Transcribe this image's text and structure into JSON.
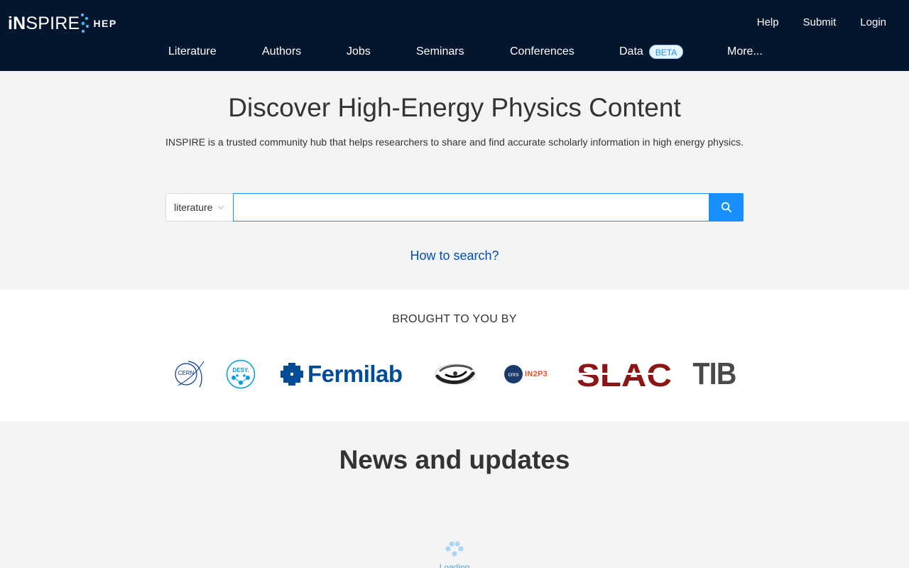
{
  "header": {
    "logo_text_bold": "iN",
    "logo_text_rest": "SPIRE",
    "logo_sub": "HEP",
    "top_links": [
      "Help",
      "Submit",
      "Login"
    ],
    "nav": [
      {
        "label": "Literature"
      },
      {
        "label": "Authors"
      },
      {
        "label": "Jobs"
      },
      {
        "label": "Seminars"
      },
      {
        "label": "Conferences"
      },
      {
        "label": "Data",
        "badge": "BETA"
      },
      {
        "label": "More..."
      }
    ]
  },
  "hero": {
    "title": "Discover High-Energy Physics Content",
    "subtitle": "INSPIRE is a trusted community hub that helps researchers to share and find accurate scholarly information in high energy physics.",
    "search": {
      "scope": "literature",
      "value": "",
      "placeholder": ""
    },
    "how_to_search": "How to search?"
  },
  "sponsors": {
    "title": "BROUGHT TO YOU BY",
    "cern": "CERN",
    "desy": "DESY.",
    "fermilab": "Fermilab",
    "cnrs": "cnrs",
    "in2p3": "IN2P3",
    "slac": "SLAC",
    "tib": "TIB"
  },
  "news": {
    "title": "News and updates",
    "loading_text": "Loading"
  },
  "colors": {
    "header_bg": "#04152e",
    "accent": "#1890ff",
    "link": "#0050b3",
    "logo_dots": "#4fc3f7",
    "fermilab_blue": "#004c97",
    "slac_red": "#8c1515"
  }
}
